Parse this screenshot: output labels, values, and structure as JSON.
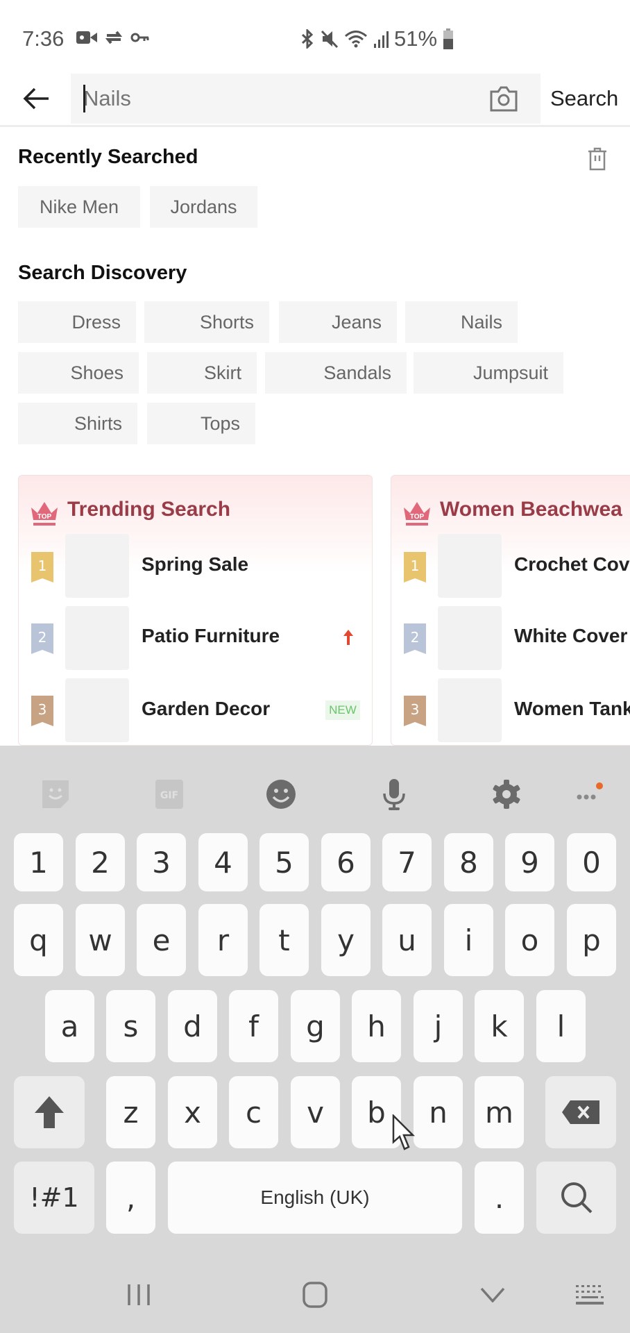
{
  "status_bar": {
    "time": "7:36",
    "battery": "51%",
    "left_icons": [
      "video-record-icon",
      "sync-car-icon",
      "vpn-key-icon"
    ],
    "right_icons": [
      "bluetooth-icon",
      "mute-icon",
      "wifi-icon",
      "signal-icon",
      "battery-icon"
    ]
  },
  "search": {
    "placeholder": "Nails",
    "value": "",
    "submit_label": "Search"
  },
  "recent": {
    "title": "Recently Searched",
    "items": [
      "Nike Men",
      "Jordans"
    ]
  },
  "discovery": {
    "title": "Search Discovery",
    "items": [
      "Dress",
      "Shorts",
      "Jeans",
      "Nails",
      "Shoes",
      "Skirt",
      "Sandals",
      "Jumpsuit",
      "Shirts",
      "Tops"
    ]
  },
  "cards": [
    {
      "title": "Trending Search",
      "items": [
        {
          "rank": "1",
          "name": "Spring Sale",
          "tag": ""
        },
        {
          "rank": "2",
          "name": "Patio Furniture",
          "tag": "up"
        },
        {
          "rank": "3",
          "name": "Garden Decor",
          "tag": "NEW"
        }
      ]
    },
    {
      "title": "Women Beachwea",
      "items": [
        {
          "rank": "1",
          "name": "Crochet Cove",
          "tag": ""
        },
        {
          "rank": "2",
          "name": "White Cover",
          "tag": ""
        },
        {
          "rank": "3",
          "name": "Women Tank",
          "tag": ""
        }
      ]
    }
  ],
  "rank_colors": {
    "1": "#e9c46e",
    "2": "#b9c4d9",
    "3": "#c7a283"
  },
  "accent_color": "#9a3c47",
  "keyboard": {
    "toolbar": [
      "sticker-icon",
      "gif-icon",
      "emoji-icon",
      "microphone-icon",
      "settings-icon",
      "more-icon"
    ],
    "row_numbers": [
      "1",
      "2",
      "3",
      "4",
      "5",
      "6",
      "7",
      "8",
      "9",
      "0"
    ],
    "row_1": [
      "q",
      "w",
      "e",
      "r",
      "t",
      "y",
      "u",
      "i",
      "o",
      "p"
    ],
    "row_2": [
      "a",
      "s",
      "d",
      "f",
      "g",
      "h",
      "j",
      "k",
      "l"
    ],
    "row_3": [
      "z",
      "x",
      "c",
      "v",
      "b",
      "n",
      "m"
    ],
    "symbols_label": "!#1",
    "comma": ",",
    "space_label": "English (UK)",
    "period": "."
  },
  "nav_bar": [
    "recent-apps-icon",
    "home-icon",
    "hide-keyboard-icon",
    "keyboard-switch-icon"
  ]
}
